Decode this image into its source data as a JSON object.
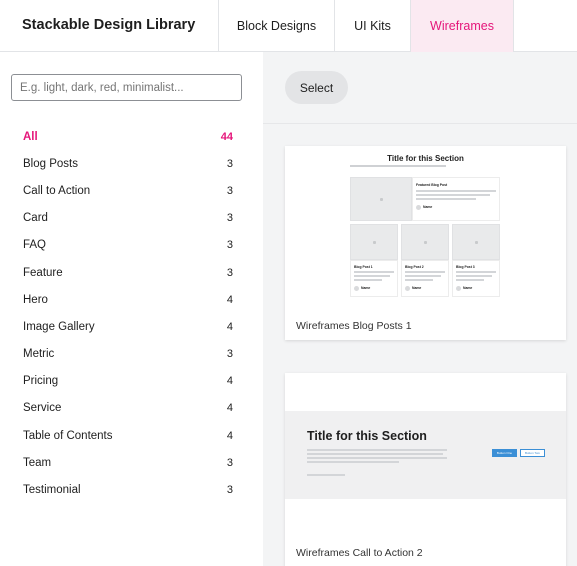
{
  "app": {
    "title": "Stackable Design Library"
  },
  "tabs": [
    {
      "label": "Block Designs",
      "active": false
    },
    {
      "label": "UI Kits",
      "active": false
    },
    {
      "label": "Wireframes",
      "active": true
    }
  ],
  "search": {
    "placeholder": "E.g. light, dark, red, minimalist...",
    "value": ""
  },
  "categories": [
    {
      "label": "All",
      "count": "44",
      "active": true
    },
    {
      "label": "Blog Posts",
      "count": "3"
    },
    {
      "label": "Call to Action",
      "count": "3"
    },
    {
      "label": "Card",
      "count": "3"
    },
    {
      "label": "FAQ",
      "count": "3"
    },
    {
      "label": "Feature",
      "count": "3"
    },
    {
      "label": "Hero",
      "count": "4"
    },
    {
      "label": "Image Gallery",
      "count": "4"
    },
    {
      "label": "Metric",
      "count": "3"
    },
    {
      "label": "Pricing",
      "count": "4"
    },
    {
      "label": "Service",
      "count": "4"
    },
    {
      "label": "Table of Contents",
      "count": "4"
    },
    {
      "label": "Team",
      "count": "3"
    },
    {
      "label": "Testimonial",
      "count": "3"
    }
  ],
  "toolbar": {
    "select_label": "Select"
  },
  "designs": [
    {
      "label": "Wireframes Blog Posts 1",
      "preview": {
        "title": "Title for this Section",
        "featured": "Featured Blog Post",
        "posts": [
          "Blog Post 1",
          "Blog Post 2",
          "Blog Post 3"
        ],
        "author": "Name"
      }
    },
    {
      "label": "Wireframes Call to Action 2",
      "preview": {
        "title": "Title for this Section",
        "button_primary": "Button One",
        "button_secondary": "Button Two"
      }
    }
  ],
  "colors": {
    "accent": "#e5157a",
    "accent_bg": "#fbeaf2",
    "button_blue": "#3b8fd6"
  }
}
